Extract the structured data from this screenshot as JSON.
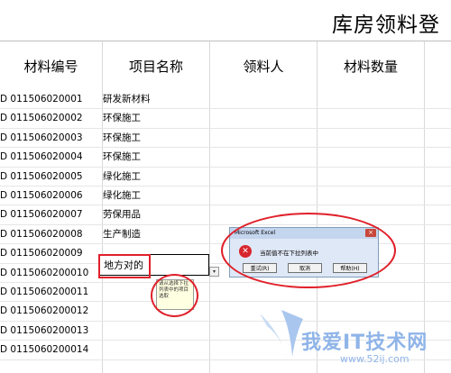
{
  "sheet": {
    "title": "库房领料登",
    "headers": [
      "材料编号",
      "项目名称",
      "领料人",
      "材料数量"
    ],
    "rows": [
      {
        "code": "D  011506020001",
        "project": "研发新材料"
      },
      {
        "code": "D  011506020002",
        "project": "环保施工"
      },
      {
        "code": "D  011506020003",
        "project": "环保施工"
      },
      {
        "code": "D  011506020004",
        "project": "环保施工"
      },
      {
        "code": "D  011506020005",
        "project": "绿化施工"
      },
      {
        "code": "D  011506020006",
        "project": "绿化施工"
      },
      {
        "code": "D  011506020007",
        "project": "劳保用品"
      },
      {
        "code": "D  011506020008",
        "project": "生产制造"
      },
      {
        "code": "D  011506020009",
        "project": ""
      },
      {
        "code": "D  0115060200010",
        "project": ""
      },
      {
        "code": "D  0115060200011",
        "project": ""
      },
      {
        "code": "D  0115060200012",
        "project": ""
      },
      {
        "code": "D  0115060200013",
        "project": ""
      },
      {
        "code": "D  0115060200014",
        "project": ""
      }
    ],
    "editing_value": "地方对的",
    "dropdown_arrow": "▾"
  },
  "tooltip": {
    "text": "请从选择下拉列表中的项目选取"
  },
  "dialog": {
    "title": "Microsoft Excel",
    "message": "当前值不在下拉列表中",
    "buttons": [
      "重试(R)",
      "取消",
      "帮助(H)"
    ],
    "close_glyph": "×",
    "icon": "error-icon",
    "icon_glyph": "✕"
  },
  "watermark": {
    "text": "我爱IT技术网",
    "url": "www.52ij.com"
  },
  "colors": {
    "annotation": "#e0202a",
    "watermark": "#8fb4e8"
  }
}
